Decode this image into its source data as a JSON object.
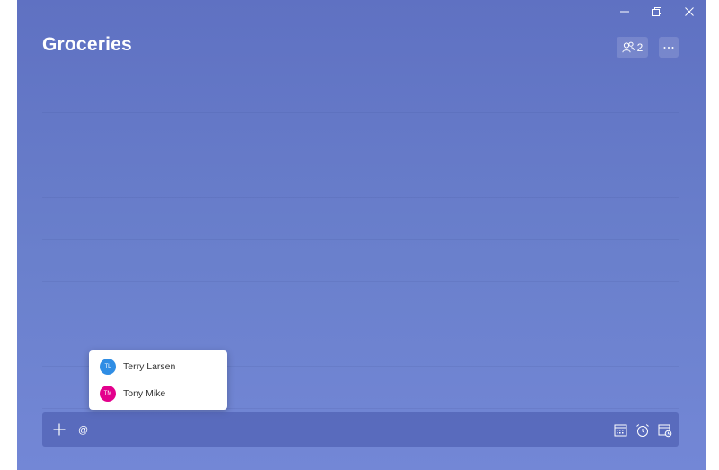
{
  "window": {
    "controls": {
      "minimize_icon": "minimize-icon",
      "restore_icon": "restore-icon",
      "close_icon": "close-icon"
    }
  },
  "list": {
    "title": "Groceries",
    "share_count": "2",
    "share_icon": "people-icon",
    "more_icon": "more-icon"
  },
  "mention_popup": {
    "people": [
      {
        "initials": "TL",
        "name": "Terry Larsen",
        "color": "#2f8de4"
      },
      {
        "initials": "TM",
        "name": "Tony Mike",
        "color": "#e3008c"
      }
    ]
  },
  "add_task": {
    "plus_icon": "plus-icon",
    "value": "@",
    "placeholder": "",
    "icons": [
      "calendar-icon",
      "alarm-icon",
      "repeat-icon"
    ]
  },
  "colors": {
    "background_top": "#5f71c2",
    "background_bottom": "#7387d6",
    "popup_bg": "#ffffff",
    "text_light": "#ffffff"
  }
}
